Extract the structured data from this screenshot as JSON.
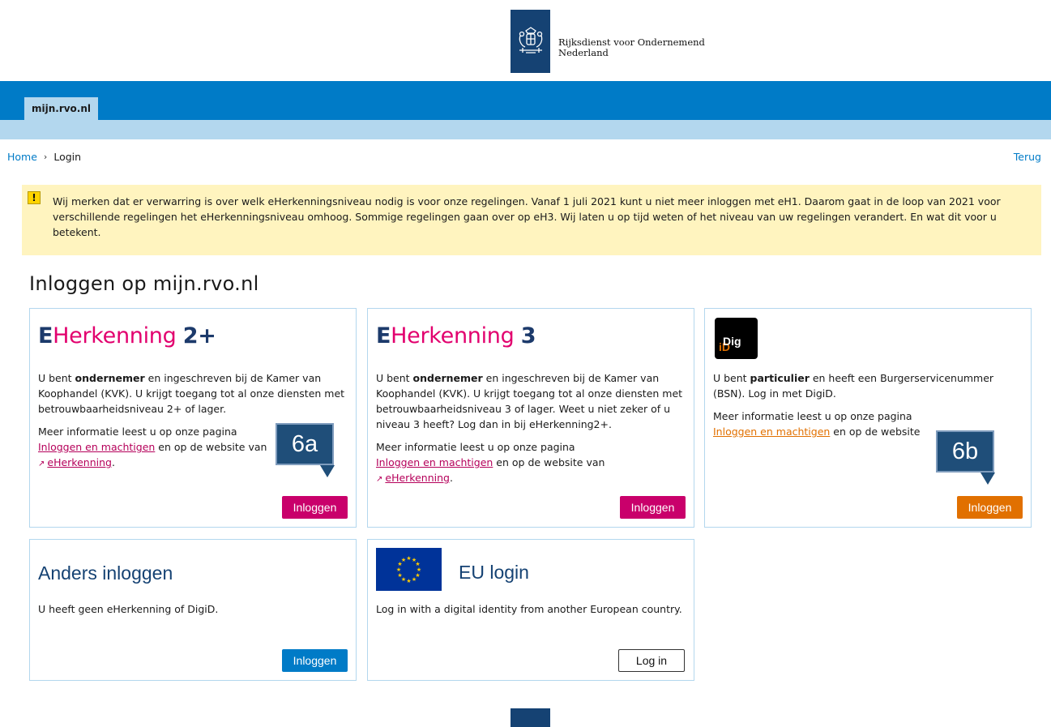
{
  "header": {
    "logo_line1": "Rijksdienst voor Ondernemend",
    "logo_line2": "Nederland",
    "site_tab": "mijn.rvo.nl"
  },
  "breadcrumb": {
    "home": "Home",
    "separator": "›",
    "current": "Login",
    "back": "Terug"
  },
  "alert": {
    "icon": "!",
    "text": "Wij merken dat er verwarring is over welk eHerkenningsniveau nodig is voor onze regelingen. Vanaf 1 juli 2021 kunt u niet meer inloggen met eH1. Daarom gaat in de loop van 2021 voor verschillende regelingen het eHerkenningsniveau omhoog. Sommige regelingen gaan over op eH3. Wij laten u op tijd weten of het niveau van uw regelingen verandert. En wat dit voor u betekent."
  },
  "page_title": "Inloggen op mijn.rvo.nl",
  "cards": {
    "eh2": {
      "logo_e": "E",
      "logo_word": "Herkenning",
      "logo_num": "2+",
      "p1_pre": "U bent ",
      "p1_bold": "ondernemer",
      "p1_post": " en ingeschreven bij de Kamer van Koophandel (KVK). U krijgt toegang tot al onze diensten met betrouwbaarheidsniveau 2+ of lager.",
      "p2_pre": "Meer informatie leest u op onze pagina",
      "link1": "Inloggen en machtigen",
      "p2_mid": " en op de website van",
      "link2": "eHerkenning",
      "p2_end": ".",
      "button": "Inloggen"
    },
    "eh3": {
      "logo_e": "E",
      "logo_word": "Herkenning",
      "logo_num": "3",
      "p1_pre": "U bent ",
      "p1_bold": "ondernemer",
      "p1_post": " en ingeschreven bij de Kamer van Koophandel (KVK). U krijgt toegang tot al onze diensten met betrouwbaarheidsniveau 3 of lager. Weet u niet zeker of u niveau 3 heeft? Log dan in bij eHerkenning2+.",
      "p2_pre": "Meer informatie leest u op onze pagina",
      "link1": "Inloggen en machtigen",
      "p2_mid": " en op de website van",
      "link2": "eHerkenning",
      "p2_end": ".",
      "button": "Inloggen"
    },
    "digid": {
      "logo_a": "Dig",
      "logo_b": "iD",
      "p1_pre": "U bent ",
      "p1_bold": "particulier",
      "p1_post": " en heeft een Burgerservicenummer (BSN). Log in met DigiD.",
      "p2_pre": "Meer informatie leest u op onze pagina",
      "link1": "Inloggen en machtigen",
      "p2_mid": " en op de website",
      "button": "Inloggen"
    },
    "anders": {
      "title": "Anders inloggen",
      "text": "U heeft geen eHerkenning of DigiD.",
      "button": "Inloggen"
    },
    "eu": {
      "title": "EU login",
      "text": "Log in with a digital identity from another European country.",
      "button": "Log in"
    }
  },
  "callouts": {
    "a": "6a",
    "b": "6b"
  },
  "colors": {
    "brand_blue": "#007bc7",
    "light_blue": "#b3d7ee",
    "dark_blue": "#154273",
    "pink": "#c9006b",
    "orange": "#e17000",
    "alert_bg": "#fff4bf"
  }
}
